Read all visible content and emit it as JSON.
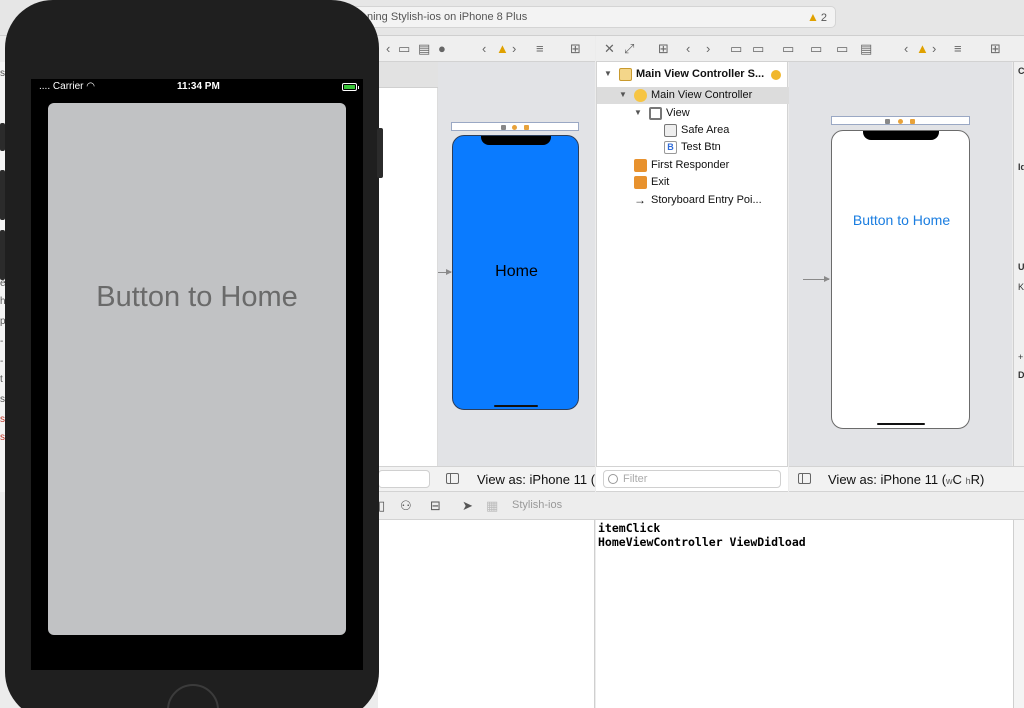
{
  "toolbar": {
    "activity_text": "ning Stylish-ios on iPhone 8 Plus",
    "warning_count": "2"
  },
  "simulator": {
    "carrier": "Carrier",
    "time": "11:34 PM",
    "button_label": "Button to Home"
  },
  "left_canvas": {
    "home_label": "Home",
    "view_as": "View as: iPhone 11 ("
  },
  "outline": {
    "scene": "Main View Controller S...",
    "controller": "Main View Controller",
    "view": "View",
    "safe_area": "Safe Area",
    "test_btn": "Test Btn",
    "first_responder": "First Responder",
    "exit": "Exit",
    "entry_point": "Storyboard Entry Poi...",
    "filter_placeholder": "Filter"
  },
  "right_canvas": {
    "button_label": "Button to Home",
    "view_as_prefix": "View as: iPhone 11 (",
    "size_w": "w",
    "size_c": "C",
    "size_h": "h",
    "size_r": "R",
    "view_as_suffix": ")"
  },
  "debug": {
    "process": "Stylish-ios",
    "console_lines": [
      "itemClick",
      "HomeViewController ViewDidload"
    ]
  },
  "colors": {
    "blue_view": "#0a7bff",
    "button_tint": "#1a7de0",
    "warning": "#e0a100"
  }
}
